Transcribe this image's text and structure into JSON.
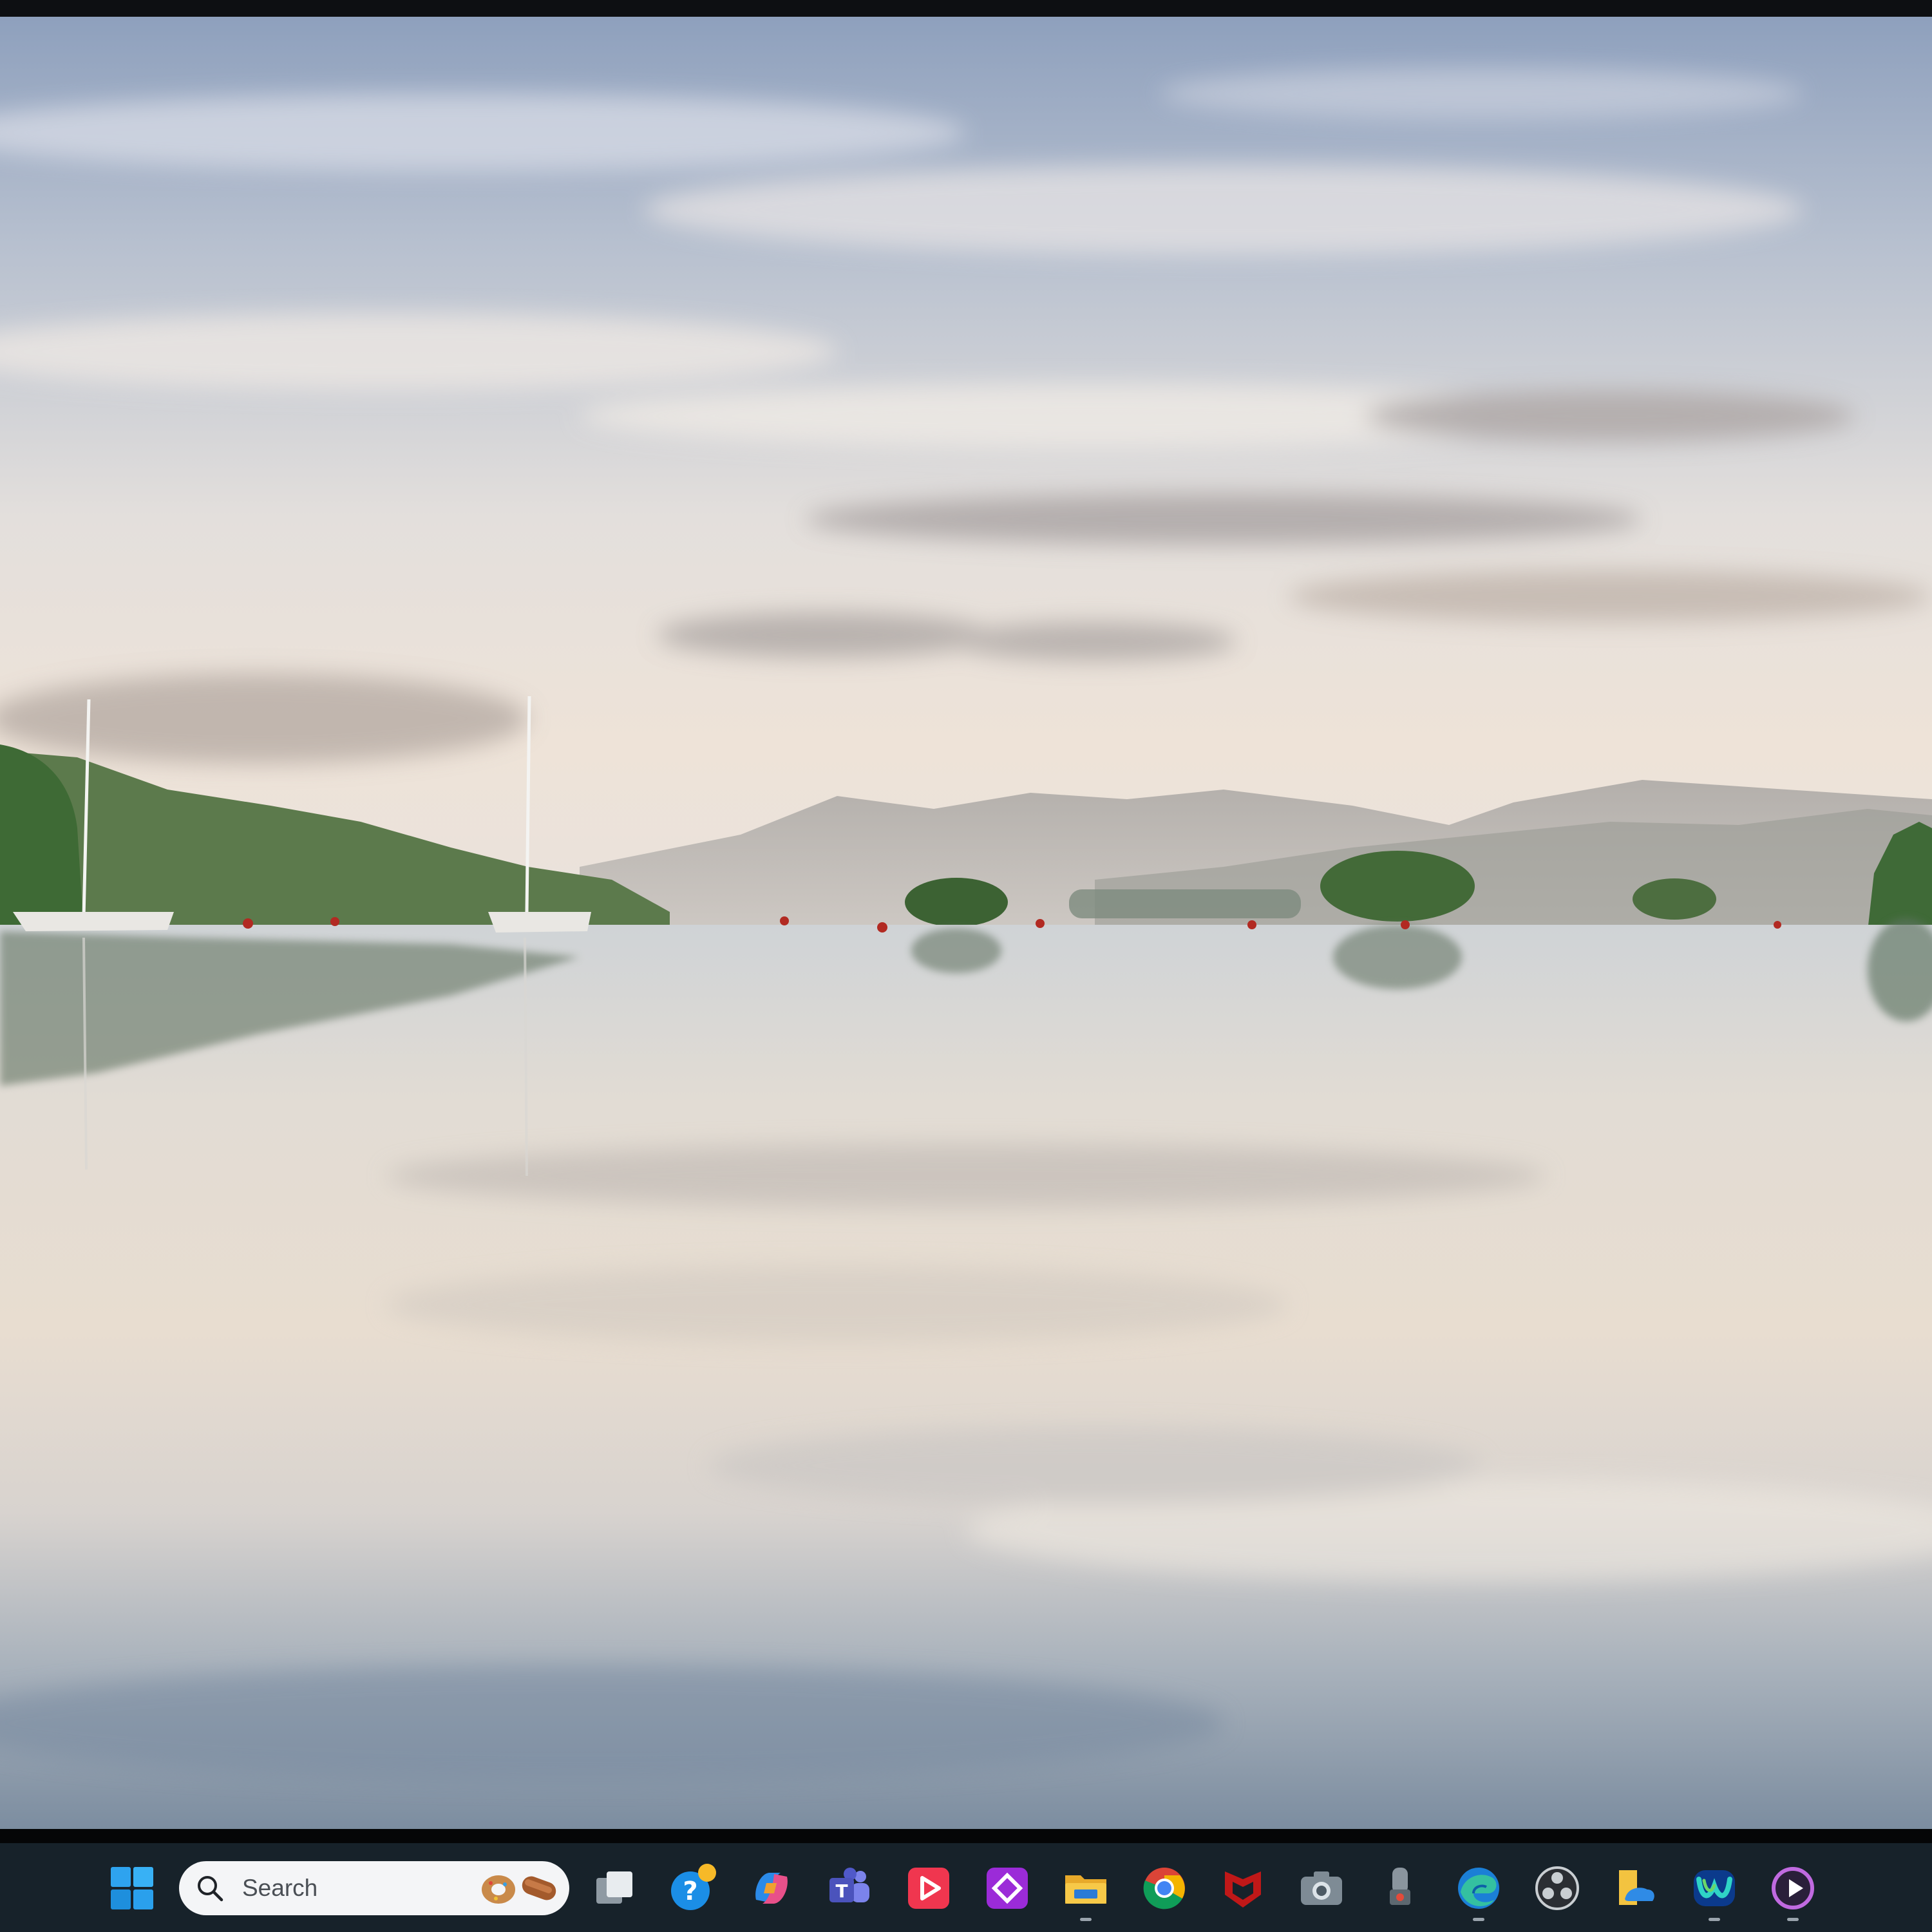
{
  "desktop": {
    "wallpaper": "lake-reflection-landscape"
  },
  "taskbar": {
    "background": "#17222a",
    "search": {
      "placeholder": "Search",
      "icon": "search-icon"
    },
    "pinned": [
      {
        "name": "start-icon",
        "running": false
      },
      {
        "name": "task-view-icon",
        "running": false
      },
      {
        "name": "get-help-icon",
        "running": false
      },
      {
        "name": "copilot-icon",
        "running": false
      },
      {
        "name": "teams-icon",
        "running": false
      },
      {
        "name": "media-player-icon",
        "running": false
      },
      {
        "name": "power-automate-icon",
        "running": false
      },
      {
        "name": "file-explorer-icon",
        "running": true
      },
      {
        "name": "chrome-icon",
        "running": false
      },
      {
        "name": "mcafee-icon",
        "running": false
      },
      {
        "name": "camera-icon",
        "running": false
      },
      {
        "name": "voice-recorder-icon",
        "running": false
      },
      {
        "name": "edge-icon",
        "running": true
      },
      {
        "name": "obs-studio-icon",
        "running": false
      },
      {
        "name": "file-manager-icon",
        "running": false
      },
      {
        "name": "webex-icon",
        "running": true
      },
      {
        "name": "clipchamp-icon",
        "running": true
      }
    ]
  }
}
